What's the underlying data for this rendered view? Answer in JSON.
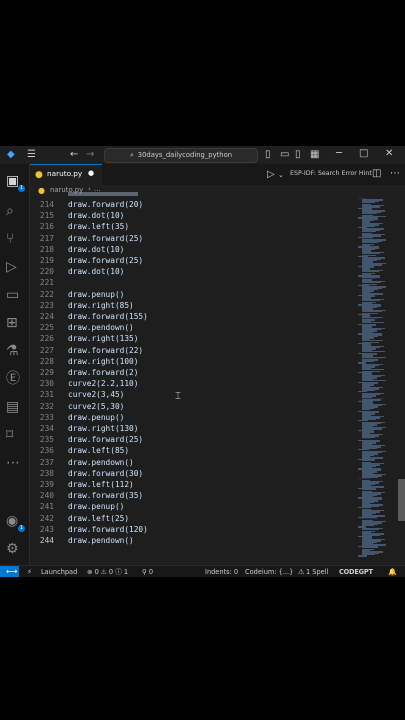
{
  "window": {
    "search_text": "30days_dailycoding_python",
    "extension_label": "ESP-IDF: Search Error Hint"
  },
  "tab": {
    "filename": "naruto.py",
    "dirty_marker": "●"
  },
  "breadcrumb": {
    "file": "naruto.py",
    "separator": "›",
    "rest": "..."
  },
  "code": {
    "lines": [
      {
        "num": "214",
        "text": "draw.forward(20)"
      },
      {
        "num": "215",
        "text": "draw.dot(10)"
      },
      {
        "num": "216",
        "text": "draw.left(35)"
      },
      {
        "num": "217",
        "text": "draw.forward(25)"
      },
      {
        "num": "218",
        "text": "draw.dot(10)"
      },
      {
        "num": "219",
        "text": "draw.forward(25)"
      },
      {
        "num": "220",
        "text": "draw.dot(10)"
      },
      {
        "num": "221",
        "text": ""
      },
      {
        "num": "222",
        "text": "draw.penup()"
      },
      {
        "num": "223",
        "text": "draw.right(85)"
      },
      {
        "num": "224",
        "text": "draw.forward(155)"
      },
      {
        "num": "225",
        "text": "draw.pendown()"
      },
      {
        "num": "226",
        "text": "draw.right(135)"
      },
      {
        "num": "227",
        "text": "draw.forward(22)"
      },
      {
        "num": "228",
        "text": "draw.right(100)"
      },
      {
        "num": "229",
        "text": "draw.forward(2)"
      },
      {
        "num": "230",
        "text": "curve2(2.2,110)"
      },
      {
        "num": "231",
        "text": "curve2(3,45)"
      },
      {
        "num": "232",
        "text": "curve2(5,30)"
      },
      {
        "num": "233",
        "text": "draw.penup()"
      },
      {
        "num": "234",
        "text": "draw.right(130)"
      },
      {
        "num": "235",
        "text": "draw.forward(25)"
      },
      {
        "num": "236",
        "text": "draw.left(85)"
      },
      {
        "num": "237",
        "text": "draw.pendown()"
      },
      {
        "num": "238",
        "text": "draw.forward(30)"
      },
      {
        "num": "239",
        "text": "draw.left(112)"
      },
      {
        "num": "240",
        "text": "draw.forward(35)"
      },
      {
        "num": "241",
        "text": "draw.penup()"
      },
      {
        "num": "242",
        "text": "draw.left(25)"
      },
      {
        "num": "243",
        "text": "draw.forward(120)"
      },
      {
        "num": "244",
        "text": "draw.pendown()"
      }
    ]
  },
  "status": {
    "launchpad": "Launchpad",
    "problems": "⊗ 0 ⚠ 0 ⓘ 1",
    "ports": "⚲ 0",
    "indents": "Indents: 0",
    "codeium": "Codeium: {...}",
    "spell": "1 Spell",
    "codegpt": "CODEGPT"
  },
  "colors": {
    "accent": "#0078d4",
    "background": "#1e1e1e",
    "code_text": "#cfe5ff"
  }
}
